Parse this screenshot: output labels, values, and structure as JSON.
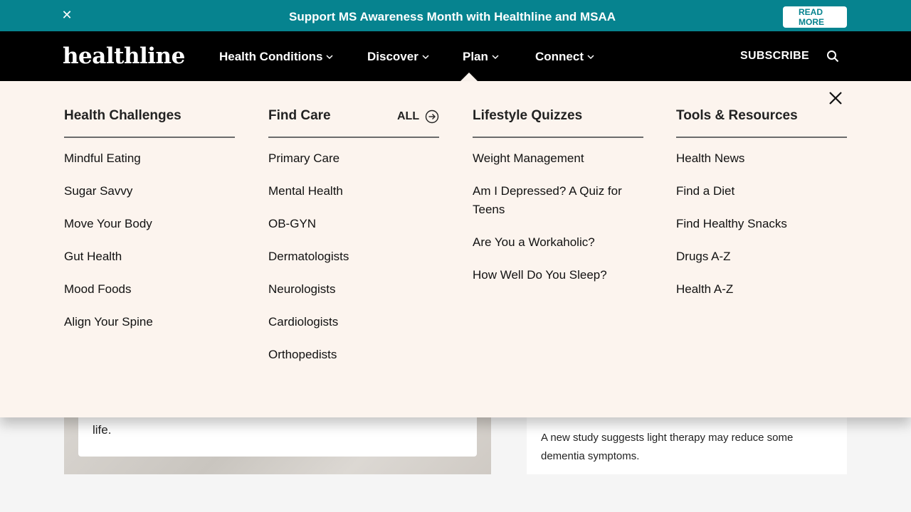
{
  "banner": {
    "promo_text": "Support MS Awareness Month with Healthline and MSAA",
    "read_more_label": "READ MORE",
    "close_symbol": "✕"
  },
  "nav": {
    "logo_text": "healthline",
    "links": [
      {
        "label": "Health Conditions"
      },
      {
        "label": "Discover"
      },
      {
        "label": "Plan"
      },
      {
        "label": "Connect"
      }
    ],
    "subscribe_label": "SUBSCRIBE",
    "search_icon": "search-icon"
  },
  "mega_menu": {
    "all_label": "ALL",
    "columns": [
      {
        "heading": "Health Challenges",
        "items": [
          "Mindful Eating",
          "Sugar Savvy",
          "Move Your Body",
          "Gut Health",
          "Mood Foods",
          "Align Your Spine"
        ]
      },
      {
        "heading": "Find Care",
        "items": [
          "Primary Care",
          "Mental Health",
          "OB-GYN",
          "Dermatologists",
          "Neurologists",
          "Cardiologists",
          "Orthopedists"
        ]
      },
      {
        "heading": "Lifestyle Quizzes",
        "items": [
          "Weight Management",
          "Am I Depressed? A Quiz for Teens",
          "Are You a Workaholic?",
          "How Well Do You Sleep?"
        ]
      },
      {
        "heading": "Tools & Resources",
        "items": [
          "Health News",
          "Find a Diet",
          "Find Healthy Snacks",
          "Drugs A-Z",
          "Health A-Z"
        ]
      }
    ]
  },
  "background": {
    "hero_card_text": "life.",
    "side_text": "A new study suggests light therapy may reduce some dementia symptoms."
  },
  "colors": {
    "banner_bg": "#06838f",
    "nav_bg": "#000000",
    "menu_bg": "#fcf4ee"
  }
}
